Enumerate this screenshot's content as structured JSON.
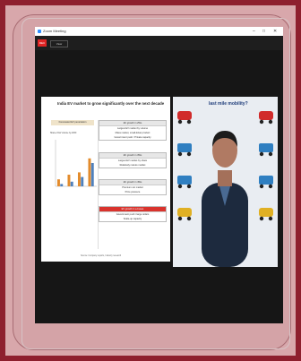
{
  "window": {
    "title": "Zoom Meeting",
    "minimize": "–",
    "maximize": "□",
    "close": "✕"
  },
  "toolbar": {
    "rec_label": "REC",
    "view_label": "View"
  },
  "slide": {
    "title": "India EV market to grow significantly over the next decade",
    "forecast_label": "Forecasted EV penetration",
    "chart_label": "Share of EV volume by 2030",
    "boxes": [
      {
        "head": "EV growth in 2Ws",
        "lines": [
          "Largest EV market by volume",
          "Mass market, small-ticket product",
          "Government push / Private capacity"
        ],
        "accent": false
      },
      {
        "head": "EV growth in 3Ws",
        "lines": [
          "Largest EV market by share",
          "Relatively mature market"
        ],
        "accent": false
      },
      {
        "head": "EV growth in 4Ws",
        "lines": [
          "Premium car market",
          "Price pressure"
        ],
        "accent": false
      },
      {
        "head": "EV growth in e-buses",
        "lines": [
          "Government push / large orders",
          "Scale-up capacity"
        ],
        "accent": true
      }
    ],
    "source": "Source: Company reports, Industry research"
  },
  "video": {
    "overlay_title": "last mile mobility?"
  },
  "colors": {
    "frame": "#8e1f2e",
    "mat": "#d4a3a7",
    "window": "#161616",
    "accent_red": "#d9332d"
  },
  "chart_data": {
    "type": "bar",
    "categories": [
      "",
      "",
      "",
      ""
    ],
    "series": [
      {
        "values": [
          15,
          25,
          30,
          60
        ]
      },
      {
        "values": [
          5,
          10,
          20,
          50
        ]
      }
    ],
    "title": "Share of EV volume by 2030",
    "xlabel": "",
    "ylabel": "",
    "ylim": [
      0,
      100
    ]
  }
}
